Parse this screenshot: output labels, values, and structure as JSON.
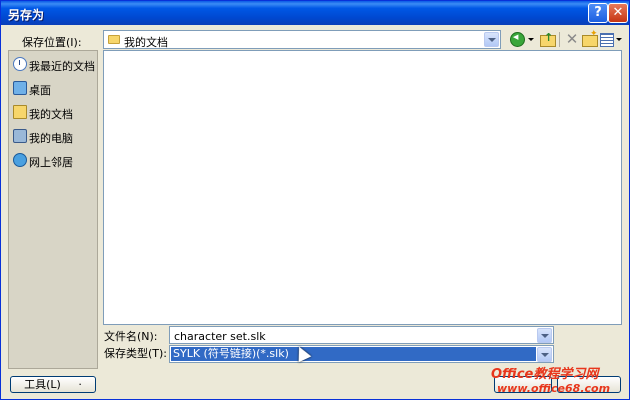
{
  "window": {
    "title": "另存为"
  },
  "titlebar": {
    "help": "?",
    "close": "✕"
  },
  "save_location": {
    "label": "保存位置(I):",
    "value": "我的文档"
  },
  "places": [
    {
      "label": "我最近的文档",
      "icon": "recent-documents-icon"
    },
    {
      "label": "桌面",
      "icon": "desktop-icon"
    },
    {
      "label": "我的文档",
      "icon": "my-documents-icon"
    },
    {
      "label": "我的电脑",
      "icon": "my-computer-icon"
    },
    {
      "label": "网上邻居",
      "icon": "network-places-icon"
    }
  ],
  "toolbar": {
    "delete": "✕"
  },
  "filename": {
    "label": "文件名(N):",
    "value": "character set.slk"
  },
  "filetype": {
    "label": "保存类型(T):",
    "value": "SYLK (符号链接)(*.slk)"
  },
  "tools_button": {
    "label": "工具(L)",
    "arrow": "·"
  },
  "watermark": {
    "brand": "Office教程学习网",
    "url": "www.office68.com"
  }
}
